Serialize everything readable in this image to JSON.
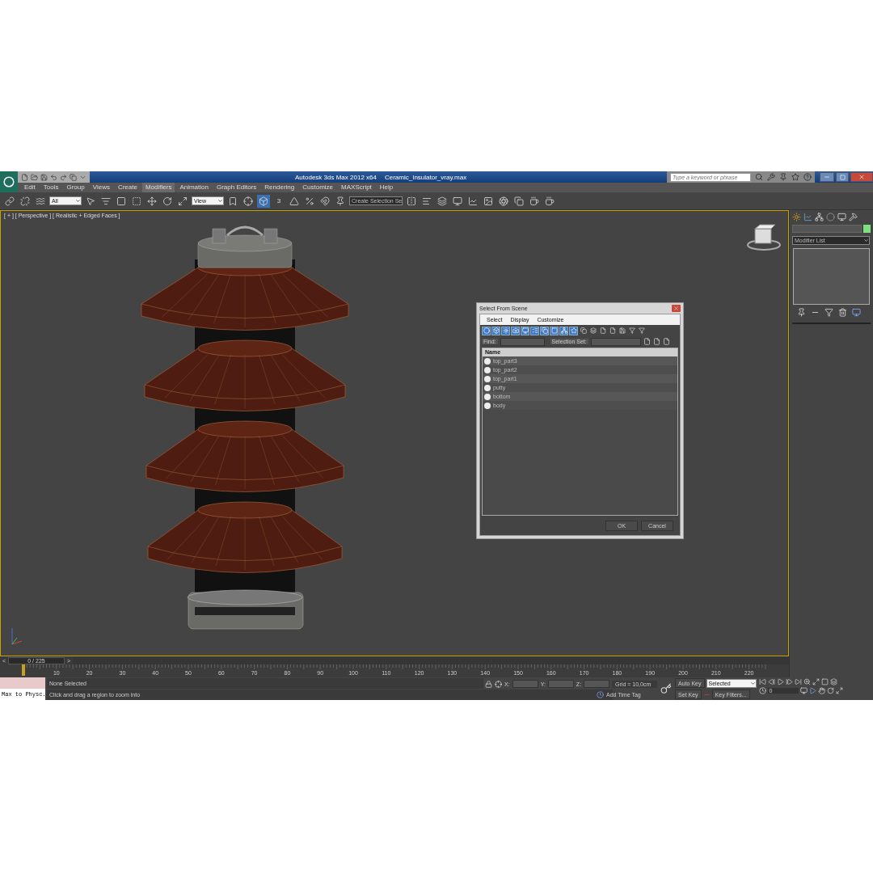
{
  "title_bar": {
    "app_title": "Autodesk 3ds Max  2012 x64",
    "file_name": "Ceramic_Insulator_vray.max",
    "search": {
      "placeholder": "Type a keyword or phrase"
    }
  },
  "menu": [
    {
      "label": "Edit",
      "selected": false
    },
    {
      "label": "Tools",
      "selected": false
    },
    {
      "label": "Group",
      "selected": false
    },
    {
      "label": "Views",
      "selected": false
    },
    {
      "label": "Create",
      "selected": false
    },
    {
      "label": "Modifiers",
      "selected": true
    },
    {
      "label": "Animation",
      "selected": false
    },
    {
      "label": "Graph Editors",
      "selected": false
    },
    {
      "label": "Rendering",
      "selected": false
    },
    {
      "label": "Customize",
      "selected": false
    },
    {
      "label": "MAXScript",
      "selected": false
    },
    {
      "label": "Help",
      "selected": false
    }
  ],
  "toolbar": {
    "selection_filter": "All",
    "reference_coord": "View",
    "snap_label": "3",
    "named_selection": "Create Selection Se"
  },
  "viewport": {
    "label": "[ + ] [ Perspective ] [ Realistic + Edged Faces ]"
  },
  "dialog": {
    "title": "Select From Scene",
    "menus": [
      "Select",
      "Display",
      "Customize"
    ],
    "find_label": "Find:",
    "selection_set_label": "Selection Set:",
    "column": "Name",
    "rows": [
      {
        "name": "top_part3"
      },
      {
        "name": "top_part2"
      },
      {
        "name": "top_part1"
      },
      {
        "name": "putty"
      },
      {
        "name": "bottom"
      },
      {
        "name": "body"
      }
    ],
    "buttons": [
      "OK",
      "Cancel"
    ]
  },
  "command_panel": {
    "modifier_list": "Modifier List"
  },
  "timeline": {
    "prev": "<",
    "next": ">",
    "slider": "0 / 225",
    "frames": [
      "10",
      "20",
      "30",
      "40",
      "50",
      "60",
      "70",
      "80",
      "90",
      "100",
      "110",
      "120",
      "130",
      "140",
      "150",
      "160",
      "170",
      "180",
      "190",
      "200",
      "210",
      "220"
    ]
  },
  "status": {
    "maxscript": "Max to Physc.",
    "selection": "None Selected",
    "prompt": "Click and drag a region to zoom into",
    "x_label": "X:",
    "y_label": "Y:",
    "z_label": "Z:",
    "grid": "Grid = 10,0cm",
    "add_time_tag": "Add Time Tag",
    "auto_key": "Auto Key",
    "key_mode": "Selected",
    "set_key": "Set Key",
    "key_filters": "Key Filters...",
    "frame": "0"
  }
}
